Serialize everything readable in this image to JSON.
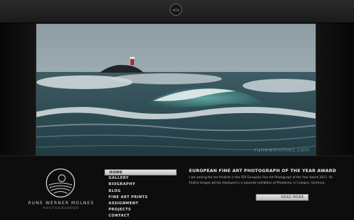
{
  "header": {
    "logo_icon": "circle-wave-logo-icon"
  },
  "photo": {
    "watermark": "runewmolnes.com",
    "subject": "storm-waves-lighthouse-photo"
  },
  "brand": {
    "name": "RUNE WERNER MOLNES",
    "role": "PHOTOGRAPHER",
    "logo_icon": "circle-wave-logo-icon"
  },
  "nav": {
    "items": [
      {
        "label": "HOME",
        "active": true
      },
      {
        "label": "GALLERY"
      },
      {
        "label": "BIOGRAPHY"
      },
      {
        "label": "BLOG"
      },
      {
        "label": "FINE ART PRINTS"
      },
      {
        "label": "ASSIGNMENT"
      },
      {
        "label": "PROJECTS"
      },
      {
        "label": "CONTACT"
      }
    ]
  },
  "news": {
    "title": "EUROPEAN FINE ART PHOTOGRAPH OF THE YEAR AWARD",
    "body": "I am among the ten finalists in the FEP European Fine Art Photograph of the Year Award 2011. All finalist images will be displayed in a separate exhibition at Photokina, in Cologne, Germany.",
    "read_more": "READ MORE"
  }
}
